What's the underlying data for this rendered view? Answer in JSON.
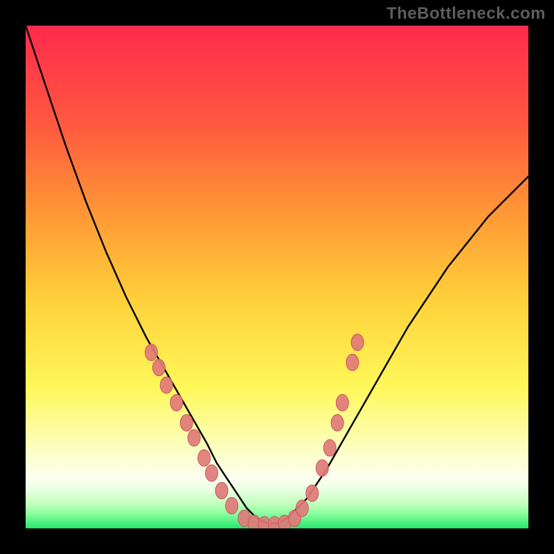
{
  "watermark": "TheBottleneck.com",
  "colors": {
    "black": "#000000",
    "watermark": "#5d5d5d",
    "curve": "#000000",
    "marker_fill": "#e07a7a",
    "marker_stroke": "#c85a5a",
    "gradient": {
      "top": "#ff2a4d",
      "upper": "#ff6a3a",
      "mid": "#ffd23a",
      "lower": "#faff7a",
      "ivory": "#fdfff0",
      "strip_top": "#e9ffe0",
      "strip_mid": "#b8ffb0",
      "bottom": "#22e86a"
    }
  },
  "chart_data": {
    "type": "line",
    "title": "",
    "xlabel": "",
    "ylabel": "",
    "xlim": [
      0,
      100
    ],
    "ylim": [
      0,
      100
    ],
    "grid": false,
    "legend": "none",
    "series": [
      {
        "name": "bottleneck-curve",
        "x": [
          0,
          4,
          8,
          12,
          16,
          20,
          24,
          28,
          32,
          36,
          38,
          40,
          42,
          44,
          46,
          48,
          50,
          52,
          56,
          60,
          64,
          68,
          72,
          76,
          80,
          84,
          88,
          92,
          96,
          100
        ],
        "y": [
          100,
          88,
          76,
          65,
          55,
          46,
          38,
          31,
          24,
          17,
          13,
          10,
          7,
          4,
          2,
          1,
          1,
          2,
          6,
          12,
          19,
          26,
          33,
          40,
          46,
          52,
          57,
          62,
          66,
          70
        ]
      }
    ],
    "markers": [
      {
        "x": 25.0,
        "y": 35.0
      },
      {
        "x": 26.5,
        "y": 32.0
      },
      {
        "x": 28.0,
        "y": 28.5
      },
      {
        "x": 30.0,
        "y": 25.0
      },
      {
        "x": 32.0,
        "y": 21.0
      },
      {
        "x": 33.5,
        "y": 18.0
      },
      {
        "x": 35.5,
        "y": 14.0
      },
      {
        "x": 37.0,
        "y": 11.0
      },
      {
        "x": 39.0,
        "y": 7.5
      },
      {
        "x": 41.0,
        "y": 4.5
      },
      {
        "x": 43.5,
        "y": 2.0
      },
      {
        "x": 45.5,
        "y": 1.0
      },
      {
        "x": 47.5,
        "y": 0.7
      },
      {
        "x": 49.5,
        "y": 0.7
      },
      {
        "x": 51.5,
        "y": 1.0
      },
      {
        "x": 53.5,
        "y": 2.0
      },
      {
        "x": 55.0,
        "y": 4.0
      },
      {
        "x": 57.0,
        "y": 7.0
      },
      {
        "x": 59.0,
        "y": 12.0
      },
      {
        "x": 60.5,
        "y": 16.0
      },
      {
        "x": 62.0,
        "y": 21.0
      },
      {
        "x": 63.0,
        "y": 25.0
      },
      {
        "x": 65.0,
        "y": 33.0
      },
      {
        "x": 66.0,
        "y": 37.0
      }
    ]
  }
}
